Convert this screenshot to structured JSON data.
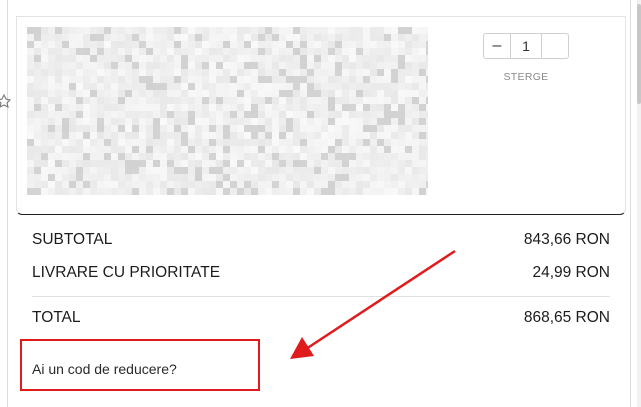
{
  "cart_item": {
    "quantity": "1",
    "minus_symbol": "–",
    "remove_label": "STERGE",
    "image_icon": "blurred-product-image"
  },
  "summary": {
    "subtotal_label": "SUBTOTAL",
    "subtotal_value": "843,66 RON",
    "shipping_label": "LIVRARE CU PRIORITATE",
    "shipping_value": "24,99 RON",
    "total_label": "TOTAL",
    "total_value": "868,65 RON"
  },
  "discount": {
    "link_label": "Ai un cod de reducere?"
  },
  "annotation": {
    "highlight_color": "#e01b1b",
    "arrow_color": "#e01b1b"
  }
}
